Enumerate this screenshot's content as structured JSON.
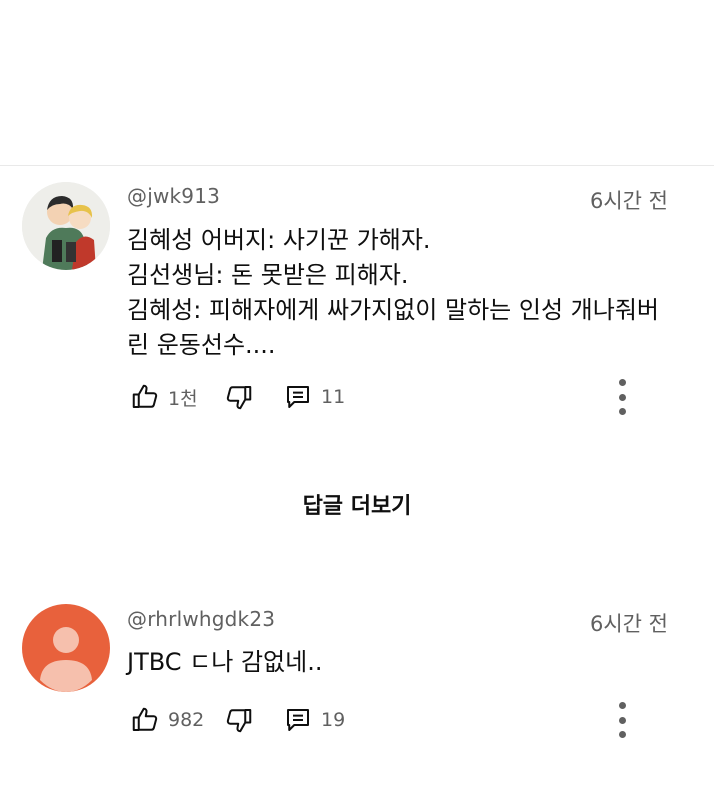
{
  "comments": [
    {
      "handle": "@jwk913",
      "time": "6시간 전",
      "lines": [
        "김혜성 어버지:  사기꾼 가해자.",
        "김선생님:  돈 못받은 피해자.",
        "김혜성:  피해자에게 싸가지없이 말하는 인성 개나줘버",
        "린  운동선수...."
      ],
      "likes": "1천",
      "replies": "11",
      "avatar": "cartoon-avatar"
    },
    {
      "handle": "@rhrlwhgdk23",
      "time": "6시간 전",
      "lines": [
        "JTBC ㄷ나 감없네.."
      ],
      "likes": "982",
      "replies": "19",
      "avatar": "default-avatar",
      "avatar_color": "#e8613c"
    }
  ],
  "more_replies_label": "답글 더보기",
  "icons": {
    "like": "thumbs-up-icon",
    "dislike": "thumbs-down-icon",
    "reply": "comment-icon",
    "menu": "more-vert-icon"
  }
}
